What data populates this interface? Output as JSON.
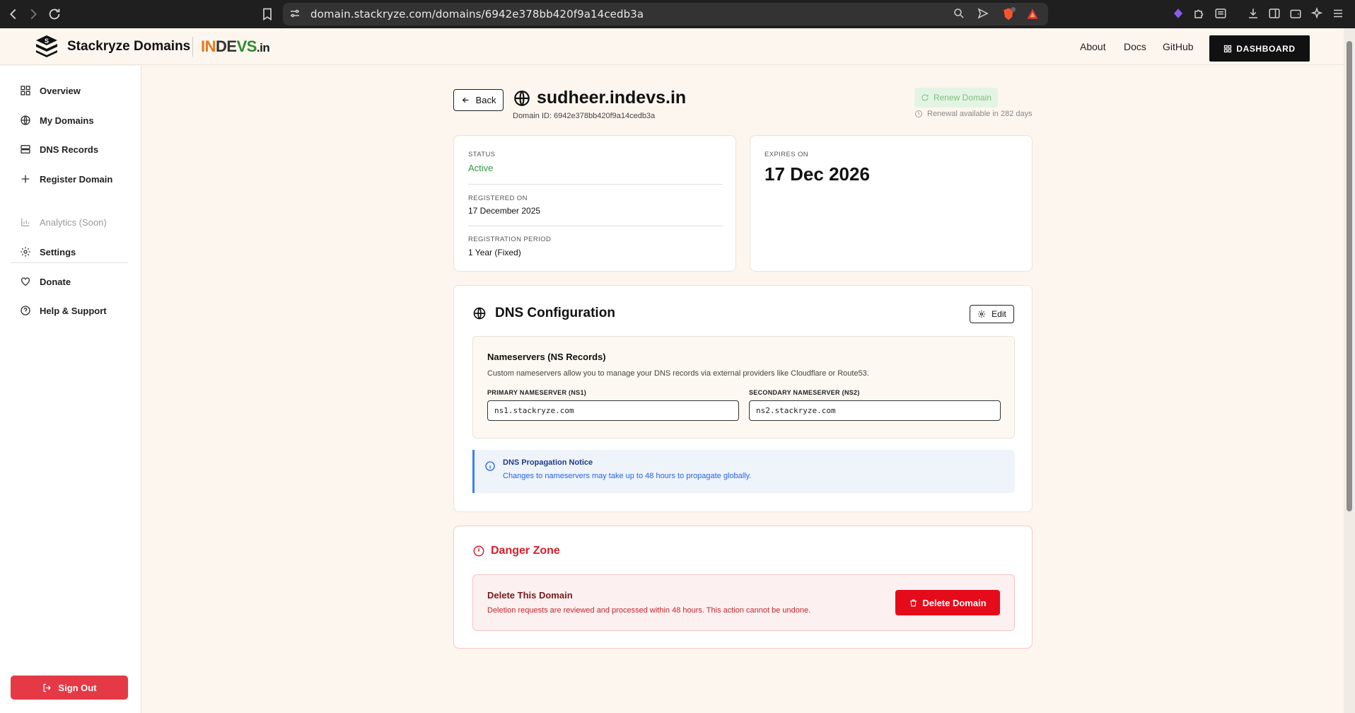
{
  "browser": {
    "url": "domain.stackryze.com/domains/6942e378bb420f9a14cedb3a"
  },
  "header": {
    "brand": "Stackryze Domains",
    "partner_logo": {
      "part1": "IN",
      "part2": "DE",
      "part3": "VS",
      "part4": ".in"
    },
    "nav": {
      "about": "About",
      "docs": "Docs",
      "github": "GitHub"
    },
    "dashboard_label": "DASHBOARD"
  },
  "sidebar": {
    "items": [
      {
        "label": "Overview",
        "icon": "grid-icon"
      },
      {
        "label": "My Domains",
        "icon": "globe-icon"
      },
      {
        "label": "DNS Records",
        "icon": "server-icon"
      },
      {
        "label": "Register Domain",
        "icon": "plus-icon"
      },
      {
        "label": "Analytics (Soon)",
        "icon": "chart-icon"
      },
      {
        "label": "Settings",
        "icon": "gear-icon"
      },
      {
        "label": "Donate",
        "icon": "heart-icon"
      },
      {
        "label": "Help & Support",
        "icon": "help-icon"
      }
    ],
    "sign_out": "Sign Out"
  },
  "domain": {
    "back_label": "Back",
    "name": "sudheer.indevs.in",
    "id_text": "Domain ID: 6942e378bb420f9a14cedb3a",
    "renew_label": "Renew Domain",
    "renewal_note": "Renewal available in 282 days"
  },
  "status_card": {
    "status_label": "STATUS",
    "status_value": "Active",
    "registered_label": "REGISTERED ON",
    "registered_value": "17 December 2025",
    "period_label": "REGISTRATION PERIOD",
    "period_value": "1 Year (Fixed)"
  },
  "expiry_card": {
    "label": "EXPIRES ON",
    "value": "17 Dec 2026"
  },
  "dns": {
    "title": "DNS Configuration",
    "edit_label": "Edit",
    "ns_title": "Nameservers (NS Records)",
    "ns_desc": "Custom nameservers allow you to manage your DNS records via external providers like Cloudflare or Route53.",
    "ns1_label": "PRIMARY NAMESERVER (NS1)",
    "ns1_value": "ns1.stackryze.com",
    "ns2_label": "SECONDARY NAMESERVER (NS2)",
    "ns2_value": "ns2.stackryze.com",
    "notice_title": "DNS Propagation Notice",
    "notice_text": "Changes to nameservers may take up to 48 hours to propagate globally."
  },
  "danger": {
    "title": "Danger Zone",
    "heading": "Delete This Domain",
    "desc": "Deletion requests are reviewed and processed within 48 hours. This action cannot be undone.",
    "delete_label": "Delete Domain"
  },
  "colors": {
    "accent_dark": "#111111",
    "status_green": "#2e9a43",
    "danger_red": "#e60b1a",
    "signout_red": "#e53946",
    "notice_blue": "#3b82f6",
    "page_bg": "#fdf6ee"
  }
}
